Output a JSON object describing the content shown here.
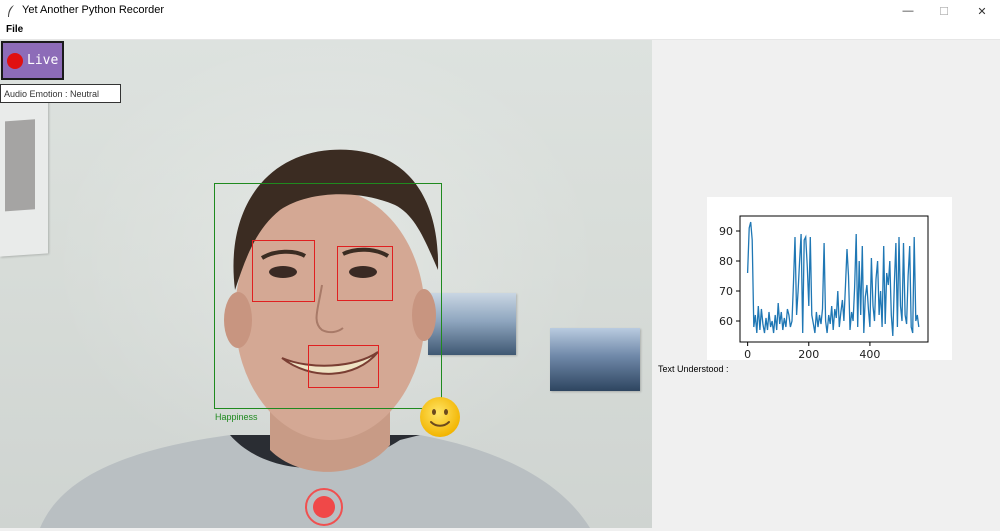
{
  "window": {
    "title": "Yet Another Python Recorder",
    "controls": [
      "—",
      "☐",
      "✕"
    ]
  },
  "menu": {
    "file": "File"
  },
  "video": {
    "live_label": "Live",
    "audio_emotion": "Audio Emotion : Neutral",
    "face_emotion": "Happiness",
    "emoji_icon": "slightly-smiling-face-icon"
  },
  "side": {
    "text_understood": "Text Understood :"
  },
  "colors": {
    "face_box": "#1f8a1f",
    "feature_box": "#e02020",
    "live_bg": "#8d6cb8",
    "record": "#f04848",
    "line": "#1f77b4"
  },
  "chart_data": {
    "type": "line",
    "title": "",
    "xlabel": "",
    "ylabel": "",
    "xlim": [
      -25,
      590
    ],
    "ylim": [
      53,
      95
    ],
    "xticks": [
      0,
      200,
      400
    ],
    "yticks": [
      60,
      70,
      80,
      90
    ],
    "series": [
      {
        "x": [
          0,
          5,
          10,
          15,
          20,
          25,
          30,
          35,
          40,
          45,
          50,
          55,
          60,
          65,
          70,
          75,
          80,
          85,
          90,
          95,
          100,
          105,
          110,
          115,
          120,
          125,
          130,
          135,
          140,
          145,
          150,
          155,
          160,
          165,
          170,
          175,
          180,
          185,
          190,
          195,
          200,
          205,
          210,
          215,
          220,
          225,
          230,
          235,
          240,
          245,
          250,
          255,
          260,
          265,
          270,
          275,
          280,
          285,
          290,
          295,
          300,
          305,
          310,
          315,
          320,
          325,
          330,
          335,
          340,
          345,
          350,
          355,
          360,
          365,
          370,
          375,
          380,
          385,
          390,
          395,
          400,
          405,
          410,
          415,
          420,
          425,
          430,
          435,
          440,
          445,
          450,
          455,
          460,
          465,
          470,
          475,
          480,
          485,
          490,
          495,
          500,
          505,
          510,
          515,
          520,
          525,
          530,
          535,
          540,
          545,
          550,
          555,
          560
        ],
        "y": [
          76,
          91,
          93,
          87,
          58,
          62,
          56,
          65,
          57,
          64,
          59,
          56,
          61,
          57,
          63,
          58,
          60,
          56,
          62,
          57,
          66,
          59,
          63,
          57,
          61,
          58,
          64,
          62,
          58,
          60,
          73,
          88,
          62,
          70,
          80,
          89,
          56,
          87,
          88,
          78,
          65,
          88,
          62,
          59,
          56,
          63,
          58,
          62,
          59,
          64,
          86,
          60,
          56,
          62,
          59,
          65,
          57,
          64,
          61,
          70,
          58,
          63,
          67,
          60,
          72,
          84,
          75,
          57,
          63,
          60,
          71,
          89,
          58,
          80,
          62,
          85,
          56,
          68,
          72,
          64,
          58,
          81,
          65,
          60,
          74,
          80,
          62,
          70,
          58,
          85,
          59,
          76,
          72,
          80,
          62,
          55,
          73,
          86,
          58,
          88,
          65,
          60,
          86,
          62,
          59,
          75,
          85,
          58,
          56,
          88,
          60,
          62,
          58
        ]
      }
    ]
  }
}
